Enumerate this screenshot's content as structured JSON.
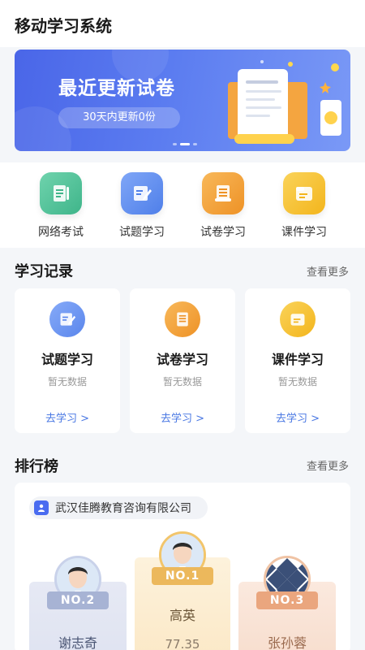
{
  "app": {
    "title": "移动学习系统"
  },
  "banner": {
    "title": "最近更新试卷",
    "subtitle": "30天内更新0份",
    "colors": {
      "start": "#4a66e8",
      "end": "#7a99f6"
    }
  },
  "quick_actions": [
    {
      "label": "网络考试",
      "icon": "exam-icon",
      "color": "#4fc19a"
    },
    {
      "label": "试题学习",
      "icon": "edit-icon",
      "color": "#5b8af0"
    },
    {
      "label": "试卷学习",
      "icon": "paper-icon",
      "color": "#f2a23c"
    },
    {
      "label": "课件学习",
      "icon": "courseware-icon",
      "color": "#f6c23a"
    }
  ],
  "records": {
    "title": "学习记录",
    "more": "查看更多",
    "cards": [
      {
        "title": "试题学习",
        "sub": "暂无数据",
        "link": "去学习 >",
        "icon": "edit-icon",
        "color": "#5b8af0"
      },
      {
        "title": "试卷学习",
        "sub": "暂无数据",
        "link": "去学习 >",
        "icon": "paper-icon",
        "color": "#f2a23c"
      },
      {
        "title": "课件学习",
        "sub": "暂无数据",
        "link": "去学习 >",
        "icon": "courseware-icon",
        "color": "#f6c23a"
      }
    ]
  },
  "ranking": {
    "title": "排行榜",
    "more": "查看更多",
    "company": "武汉佳腾教育咨询有限公司",
    "entries": [
      {
        "rank_label": "NO.1",
        "name": "高英",
        "score": "77.35"
      },
      {
        "rank_label": "NO.2",
        "name": "谢志奇"
      },
      {
        "rank_label": "NO.3",
        "name": "张孙蓉"
      }
    ]
  }
}
